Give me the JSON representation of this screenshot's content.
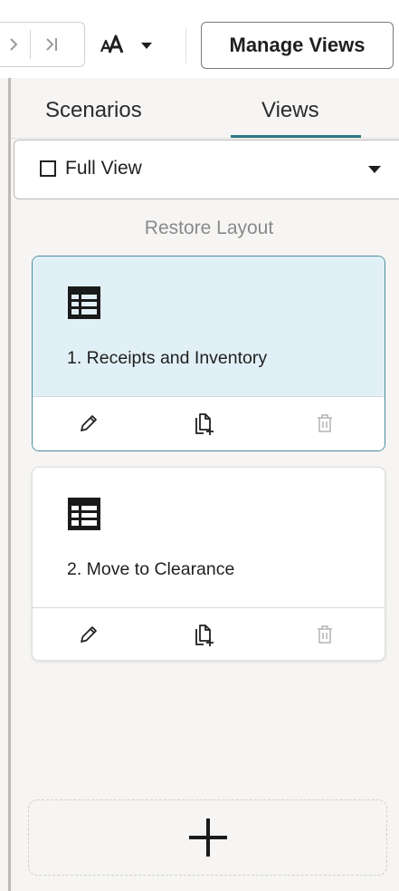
{
  "toolbar": {
    "prev_icon": "chevron-right-icon",
    "last_icon": "chevron-last-icon",
    "font_size_icon": "text-size-icon",
    "manage_views_label": "Manage Views"
  },
  "tabs": [
    {
      "label": "Scenarios",
      "selected": false
    },
    {
      "label": "Views",
      "selected": true
    }
  ],
  "view_select": {
    "value": "Full View"
  },
  "restore_layout_label": "Restore Layout",
  "cards": [
    {
      "title": "1. Receipts and Inventory",
      "selected": true,
      "icon": "table-icon",
      "actions": [
        "edit-icon",
        "duplicate-icon",
        "delete-icon"
      ]
    },
    {
      "title": "2. Move to Clearance",
      "selected": false,
      "icon": "table-icon",
      "actions": [
        "edit-icon",
        "duplicate-icon",
        "delete-icon"
      ]
    }
  ],
  "add_icon": "plus-icon",
  "colors": {
    "accent": "#2e7a87",
    "selected_card_bg": "#e1f0f6",
    "selected_card_border": "#4a8d9c",
    "panel_bg": "#f6f5f4",
    "muted_text": "#8a8a8a"
  }
}
